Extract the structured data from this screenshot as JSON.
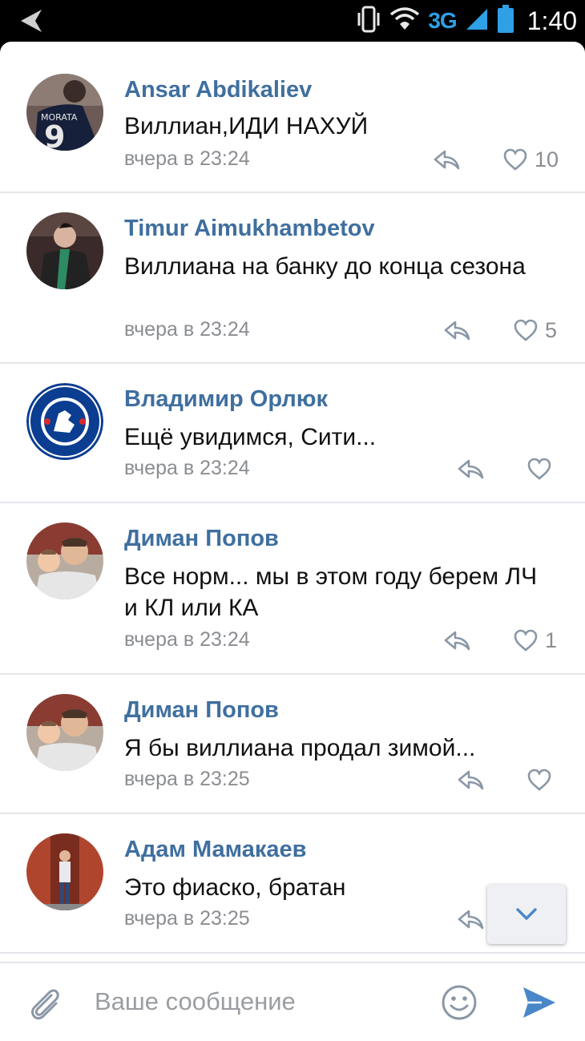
{
  "status_bar": {
    "network": "3G",
    "time": "1:40",
    "icons": [
      "back-arrow-icon",
      "vibrate-icon",
      "wifi-icon",
      "signal-icon",
      "battery-icon"
    ]
  },
  "colors": {
    "author": "#3f6f9f",
    "meta": "#8a8d91",
    "send": "#4a87c9",
    "divider": "#e4e6ea"
  },
  "comments": [
    {
      "author": "Ansar Abdikaliev",
      "text": "Виллиан,ИДИ НАХУЙ",
      "time": "вчера в 23:24",
      "likes": "10"
    },
    {
      "author": "Timur Aimukhambetov",
      "text": "Виллиана на банку до конца сезона",
      "time": "вчера в 23:24",
      "likes": "5"
    },
    {
      "author": "Владимир Орлюк",
      "text": "Ещё увидимся, Сити...",
      "time": "вчера в 23:24",
      "likes": "",
      "avatar_text": "CHELSEA · FOOTBALL CLUB"
    },
    {
      "author": "Диман Попов",
      "text": "Все норм... мы в этом году берем ЛЧ и КЛ или КА",
      "time": "вчера в 23:24",
      "likes": "1"
    },
    {
      "author": "Диман Попов",
      "text": "Я бы виллиана продал зимой...",
      "time": "вчера в 23:25",
      "likes": ""
    },
    {
      "author": "Адам Мамакаев",
      "text": "Это фиаско, братан",
      "time": "вчера в 23:25",
      "likes": ""
    }
  ],
  "composer": {
    "placeholder": "Ваше сообщение"
  }
}
